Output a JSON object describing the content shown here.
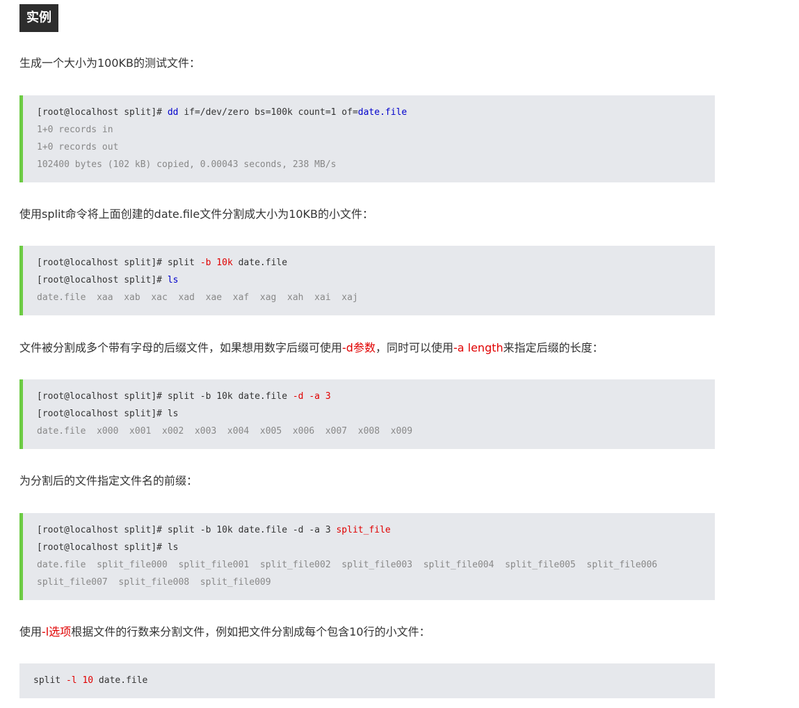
{
  "heading": "实例",
  "sections": [
    {
      "text": "生成一个大小为100KB的测试文件：",
      "code": {
        "prompt1": "[root@localhost split]# ",
        "cmd1_dd": "dd",
        "cmd1_mid": " if=/dev/zero bs=100k count=1 of=",
        "cmd1_file": "date.file",
        "out1": "1+0 records in",
        "out2": "1+0 records out",
        "out3": "102400 bytes (102 kB) copied, 0.00043 seconds, 238 MB/s"
      }
    },
    {
      "text": "使用split命令将上面创建的date.file文件分割成大小为10KB的小文件：",
      "code": {
        "prompt1": "[root@localhost split]# ",
        "cmd1_a": "split ",
        "cmd1_opt": "-b 10k",
        "cmd1_b": " date.file",
        "prompt2": "[root@localhost split]# ",
        "cmd2": "ls",
        "out1": "date.file  xaa  xab  xac  xad  xae  xaf  xag  xah  xai  xaj"
      }
    },
    {
      "text_a": "文件被分割成多个带有字母的后缀文件，如果想用数字后缀可使用",
      "text_red1": "-d参数",
      "text_b": "，同时可以使用",
      "text_red2": "-a length",
      "text_c": "来指定后缀的长度：",
      "code": {
        "prompt1": "[root@localhost split]# ",
        "cmd1_a": "split -b 10k date.file ",
        "cmd1_opt": "-d -a 3",
        "prompt2": "[root@localhost split]# ",
        "cmd2": "ls",
        "out1": "date.file  x000  x001  x002  x003  x004  x005  x006  x007  x008  x009"
      }
    },
    {
      "text": "为分割后的文件指定文件名的前缀：",
      "code": {
        "prompt1": "[root@localhost split]# ",
        "cmd1_a": "split -b 10k date.file -d -a 3 ",
        "cmd1_opt": "split_file",
        "prompt2": "[root@localhost split]# ",
        "cmd2": "ls",
        "out1": "date.file  split_file000  split_file001  split_file002  split_file003  split_file004  split_file005  split_file006",
        "out2": "split_file007  split_file008  split_file009"
      }
    },
    {
      "text_a": "使用",
      "text_red": "-l选项",
      "text_b": "根据文件的行数来分割文件，例如把文件分割成每个包含10行的小文件：",
      "code": {
        "cmd_a": "split ",
        "cmd_opt": "-l 10",
        "cmd_b": " date.file"
      }
    }
  ]
}
